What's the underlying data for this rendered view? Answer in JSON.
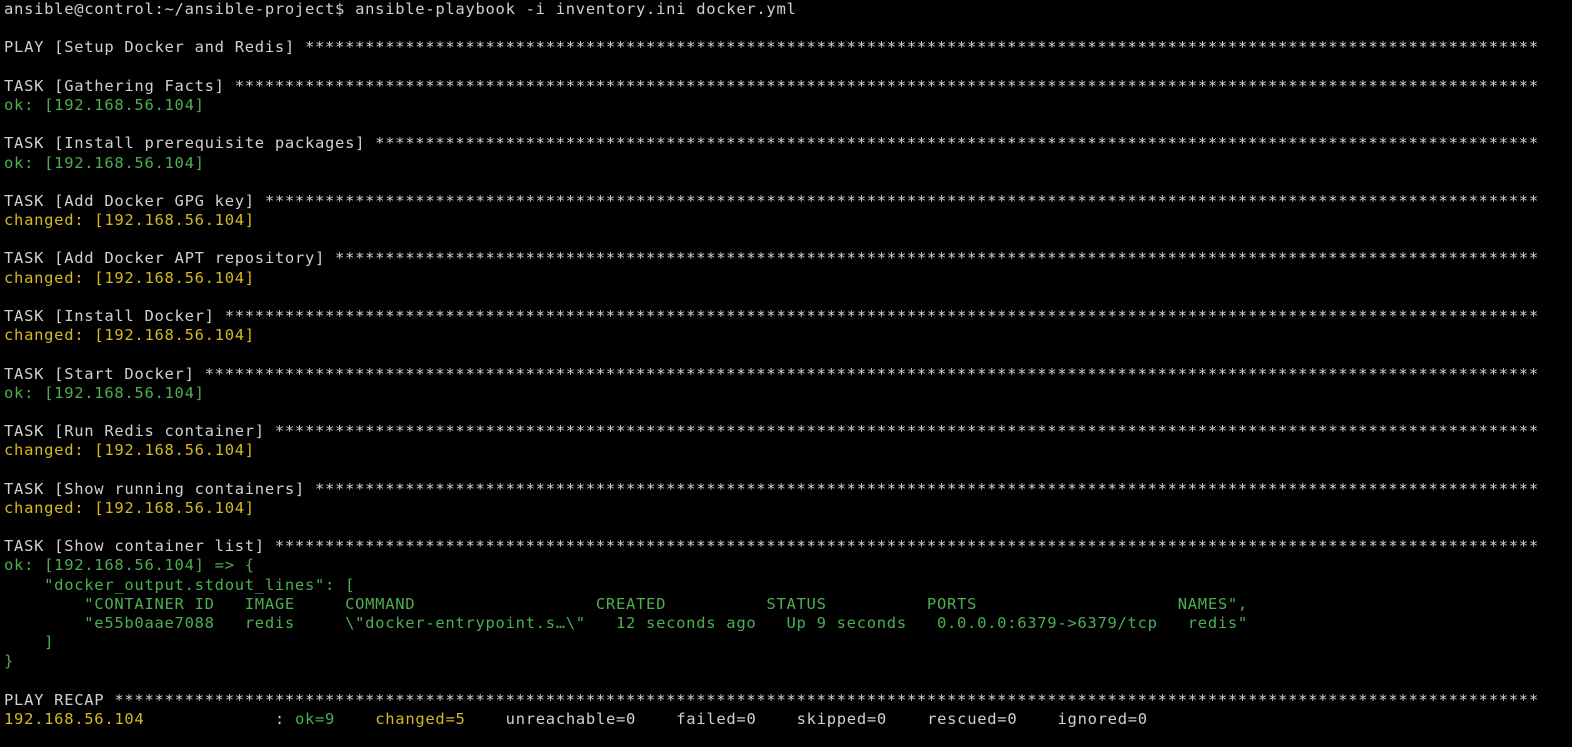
{
  "colors": {
    "background": "#000000",
    "text": "#d0d0d0",
    "ok": "#4caf50",
    "changed": "#d7b81f"
  },
  "lines": [
    {
      "color": "white",
      "text": "ansible@control:~/ansible-project$ ansible-playbook -i inventory.ini docker.yml"
    },
    {
      "color": "white",
      "text": ""
    },
    {
      "color": "white",
      "text": "PLAY [Setup Docker and Redis] ***************************************************************************************************************************"
    },
    {
      "color": "white",
      "text": ""
    },
    {
      "color": "white",
      "text": "TASK [Gathering Facts] **********************************************************************************************************************************"
    },
    {
      "color": "green",
      "text": "ok: [192.168.56.104]"
    },
    {
      "color": "white",
      "text": ""
    },
    {
      "color": "white",
      "text": "TASK [Install prerequisite packages] ********************************************************************************************************************"
    },
    {
      "color": "green",
      "text": "ok: [192.168.56.104]"
    },
    {
      "color": "white",
      "text": ""
    },
    {
      "color": "white",
      "text": "TASK [Add Docker GPG key] *******************************************************************************************************************************"
    },
    {
      "color": "yellow",
      "text": "changed: [192.168.56.104]"
    },
    {
      "color": "white",
      "text": ""
    },
    {
      "color": "white",
      "text": "TASK [Add Docker APT repository] ************************************************************************************************************************"
    },
    {
      "color": "yellow",
      "text": "changed: [192.168.56.104]"
    },
    {
      "color": "white",
      "text": ""
    },
    {
      "color": "white",
      "text": "TASK [Install Docker] ***********************************************************************************************************************************"
    },
    {
      "color": "yellow",
      "text": "changed: [192.168.56.104]"
    },
    {
      "color": "white",
      "text": ""
    },
    {
      "color": "white",
      "text": "TASK [Start Docker] *************************************************************************************************************************************"
    },
    {
      "color": "green",
      "text": "ok: [192.168.56.104]"
    },
    {
      "color": "white",
      "text": ""
    },
    {
      "color": "white",
      "text": "TASK [Run Redis container] ******************************************************************************************************************************"
    },
    {
      "color": "yellow",
      "text": "changed: [192.168.56.104]"
    },
    {
      "color": "white",
      "text": ""
    },
    {
      "color": "white",
      "text": "TASK [Show running containers] **************************************************************************************************************************"
    },
    {
      "color": "yellow",
      "text": "changed: [192.168.56.104]"
    },
    {
      "color": "white",
      "text": ""
    },
    {
      "color": "white",
      "text": "TASK [Show container list] ******************************************************************************************************************************"
    },
    {
      "color": "green",
      "text": "ok: [192.168.56.104] => {"
    },
    {
      "color": "green",
      "text": "    \"docker_output.stdout_lines\": ["
    },
    {
      "color": "green",
      "text": "        \"CONTAINER ID   IMAGE     COMMAND                  CREATED          STATUS          PORTS                    NAMES\","
    },
    {
      "color": "green",
      "text": "        \"e55b0aae7088   redis     \\\"docker-entrypoint.s…\\\"   12 seconds ago   Up 9 seconds   0.0.0.0:6379->6379/tcp   redis\""
    },
    {
      "color": "green",
      "text": "    ]"
    },
    {
      "color": "green",
      "text": "}"
    },
    {
      "color": "white",
      "text": ""
    },
    {
      "color": "white",
      "text": "PLAY RECAP **********************************************************************************************************************************************"
    }
  ],
  "recap": {
    "host": "192.168.56.104",
    "sep": "             : ",
    "ok": "ok=9",
    "changed": "changed=5",
    "unreachable": "unreachable=0",
    "failed": "failed=0",
    "skipped": "skipped=0",
    "rescued": "rescued=0",
    "ignored": "ignored=0"
  }
}
